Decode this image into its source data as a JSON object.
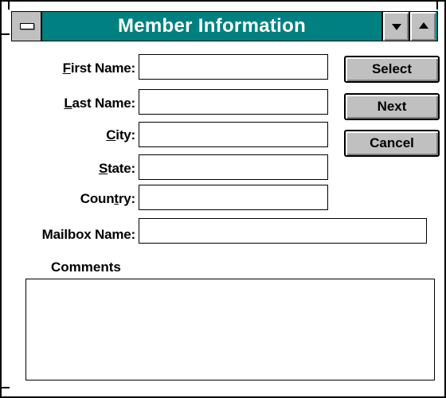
{
  "window": {
    "title": "Member Information"
  },
  "form": {
    "fields": [
      {
        "id": "first-name",
        "label_prefix": "",
        "label_mnemonic": "F",
        "label_rest": "irst Name:",
        "value": "",
        "placeholder": ""
      },
      {
        "id": "last-name",
        "label_prefix": "",
        "label_mnemonic": "L",
        "label_rest": "ast Name:",
        "value": "",
        "placeholder": ""
      },
      {
        "id": "city",
        "label_prefix": "",
        "label_mnemonic": "C",
        "label_rest": "ity:",
        "value": "",
        "placeholder": ""
      },
      {
        "id": "state",
        "label_prefix": "",
        "label_mnemonic": "S",
        "label_rest": "tate:",
        "value": "",
        "placeholder": ""
      },
      {
        "id": "country",
        "label_prefix": "Coun",
        "label_mnemonic": "t",
        "label_rest": "ry:",
        "value": "",
        "placeholder": ""
      },
      {
        "id": "mailbox-name",
        "label_prefix": "Mailbox Name:",
        "label_mnemonic": "",
        "label_rest": "",
        "value": "",
        "placeholder": ""
      }
    ],
    "comments_label": "Comments",
    "comments_value": ""
  },
  "buttons": {
    "select": "Select",
    "next": "Next",
    "cancel": "Cancel"
  },
  "icons": {
    "system_menu": "system-menu-icon",
    "minimize": "minimize-arrow-icon",
    "maximize": "maximize-arrow-icon"
  },
  "colors": {
    "titlebar": "#008080",
    "button_face": "#c0c0c0"
  }
}
